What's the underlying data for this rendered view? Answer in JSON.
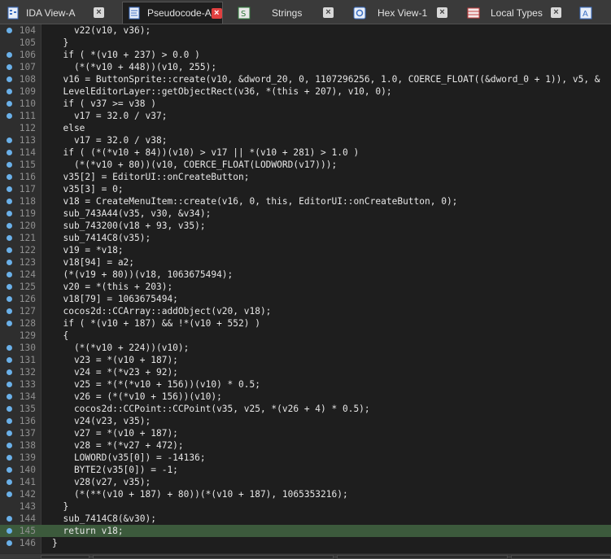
{
  "tabs": [
    {
      "label": "IDA View-A",
      "icon": "ida-view-icon",
      "active": false
    },
    {
      "label": "Pseudocode-A",
      "icon": "pseudocode-icon",
      "active": true
    },
    {
      "label": "",
      "icon": "script-icon",
      "active": false
    },
    {
      "label": "Strings",
      "icon": "strings-icon",
      "active": false
    },
    {
      "label": "Hex View-1",
      "icon": "hex-view-icon",
      "active": false
    },
    {
      "label": "Local Types",
      "icon": "local-types-icon",
      "active": false
    },
    {
      "label": "",
      "icon": "structures-icon",
      "active": false
    }
  ],
  "close_glyph": "×",
  "highlighted_line": 145,
  "colors": {
    "background": "#1e1e1e",
    "gutter": "#2e2e2e",
    "line_highlight": "#3c5a3c",
    "breakpoint_dot": "#6ab0e8",
    "active_tab_close": "#e04040",
    "variable_highlight": "#6a3a8a"
  },
  "code_lines": [
    {
      "no": "104",
      "dot": true,
      "text": "    v22(v10, v36);"
    },
    {
      "no": "105",
      "dot": false,
      "text": "  }"
    },
    {
      "no": "106",
      "dot": true,
      "text": "  if ( *(v10 + 237) > 0.0 )"
    },
    {
      "no": "107",
      "dot": true,
      "text": "    (*(*v10 + 448))(v10, 255);"
    },
    {
      "no": "108",
      "dot": true,
      "text": "  v16 = ButtonSprite::create(v10, &dword_20, 0, 1107296256, 1.0, COERCE_FLOAT((&dword_0 + 1)), v5, &"
    },
    {
      "no": "109",
      "dot": true,
      "text": "  LevelEditorLayer::getObjectRect(v36, *(this + 207), v10, 0);"
    },
    {
      "no": "110",
      "dot": true,
      "text": "  if ( v37 >= v38 )"
    },
    {
      "no": "111",
      "dot": true,
      "text": "    v17 = 32.0 / v37;"
    },
    {
      "no": "112",
      "dot": false,
      "text": "  else"
    },
    {
      "no": "113",
      "dot": true,
      "text": "    v17 = 32.0 / v38;"
    },
    {
      "no": "114",
      "dot": true,
      "text": "  if ( (*(*v10 + 84))(v10) > v17 || *(v10 + 281) > 1.0 )"
    },
    {
      "no": "115",
      "dot": true,
      "text": "    (*(*v10 + 80))(v10, COERCE_FLOAT(LODWORD(v17)));"
    },
    {
      "no": "116",
      "dot": true,
      "text": "  v35[2] = EditorUI::onCreateButton;"
    },
    {
      "no": "117",
      "dot": true,
      "text": "  v35[3] = 0;"
    },
    {
      "no": "118",
      "dot": true,
      "text": "  v18 = CreateMenuItem::create(v16, 0, this, EditorUI::onCreateButton, 0);"
    },
    {
      "no": "119",
      "dot": true,
      "text": "  sub_743A44(v35, v30, &v34);"
    },
    {
      "no": "120",
      "dot": true,
      "text": "  sub_743200(v18 + 93, v35);"
    },
    {
      "no": "121",
      "dot": true,
      "text": "  sub_7414C8(v35);"
    },
    {
      "no": "122",
      "dot": true,
      "text": "  v19 = *v18;"
    },
    {
      "no": "123",
      "dot": true,
      "text": "  v18[94] = a2;"
    },
    {
      "no": "124",
      "dot": true,
      "text": "  (*(v19 + 80))(v18, 1063675494);"
    },
    {
      "no": "125",
      "dot": true,
      "text": "  v20 = *(this + 203);"
    },
    {
      "no": "126",
      "dot": true,
      "text": "  v18[79] = 1063675494;"
    },
    {
      "no": "127",
      "dot": true,
      "text": "  cocos2d::CCArray::addObject(v20, v18);"
    },
    {
      "no": "128",
      "dot": true,
      "text": "  if ( *(v10 + 187) && !*(v10 + 552) )"
    },
    {
      "no": "129",
      "dot": false,
      "text": "  {"
    },
    {
      "no": "130",
      "dot": true,
      "text": "    (*(*v10 + 224))(v10);"
    },
    {
      "no": "131",
      "dot": true,
      "text": "    v23 = *(v10 + 187);"
    },
    {
      "no": "132",
      "dot": true,
      "text": "    v24 = *(*v23 + 92);"
    },
    {
      "no": "133",
      "dot": true,
      "text": "    v25 = *(*(*v10 + 156))(v10) * 0.5;"
    },
    {
      "no": "134",
      "dot": true,
      "text": "    v26 = (*(*v10 + 156))(v10);"
    },
    {
      "no": "135",
      "dot": true,
      "text": "    cocos2d::CCPoint::CCPoint(v35, v25, *(v26 + 4) * 0.5);"
    },
    {
      "no": "136",
      "dot": true,
      "text": "    v24(v23, v35);"
    },
    {
      "no": "137",
      "dot": true,
      "text": "    v27 = *(v10 + 187);"
    },
    {
      "no": "138",
      "dot": true,
      "text": "    v28 = *(*v27 + 472);"
    },
    {
      "no": "139",
      "dot": true,
      "text": "    LOWORD(v35[0]) = -14136;"
    },
    {
      "no": "140",
      "dot": true,
      "text": "    BYTE2(v35[0]) = -1;"
    },
    {
      "no": "141",
      "dot": true,
      "text": "    v28(v27, v35);"
    },
    {
      "no": "142",
      "dot": true,
      "text": "    (*(**(v10 + 187) + 80))(*(v10 + 187), 1065353216);"
    },
    {
      "no": "143",
      "dot": false,
      "text": "  }"
    },
    {
      "no": "144",
      "dot": true,
      "text": "  sub_7414C8(&v30);"
    },
    {
      "no": "145",
      "dot": true,
      "text": "  return v18;"
    },
    {
      "no": "146",
      "dot": true,
      "text": "}"
    }
  ]
}
